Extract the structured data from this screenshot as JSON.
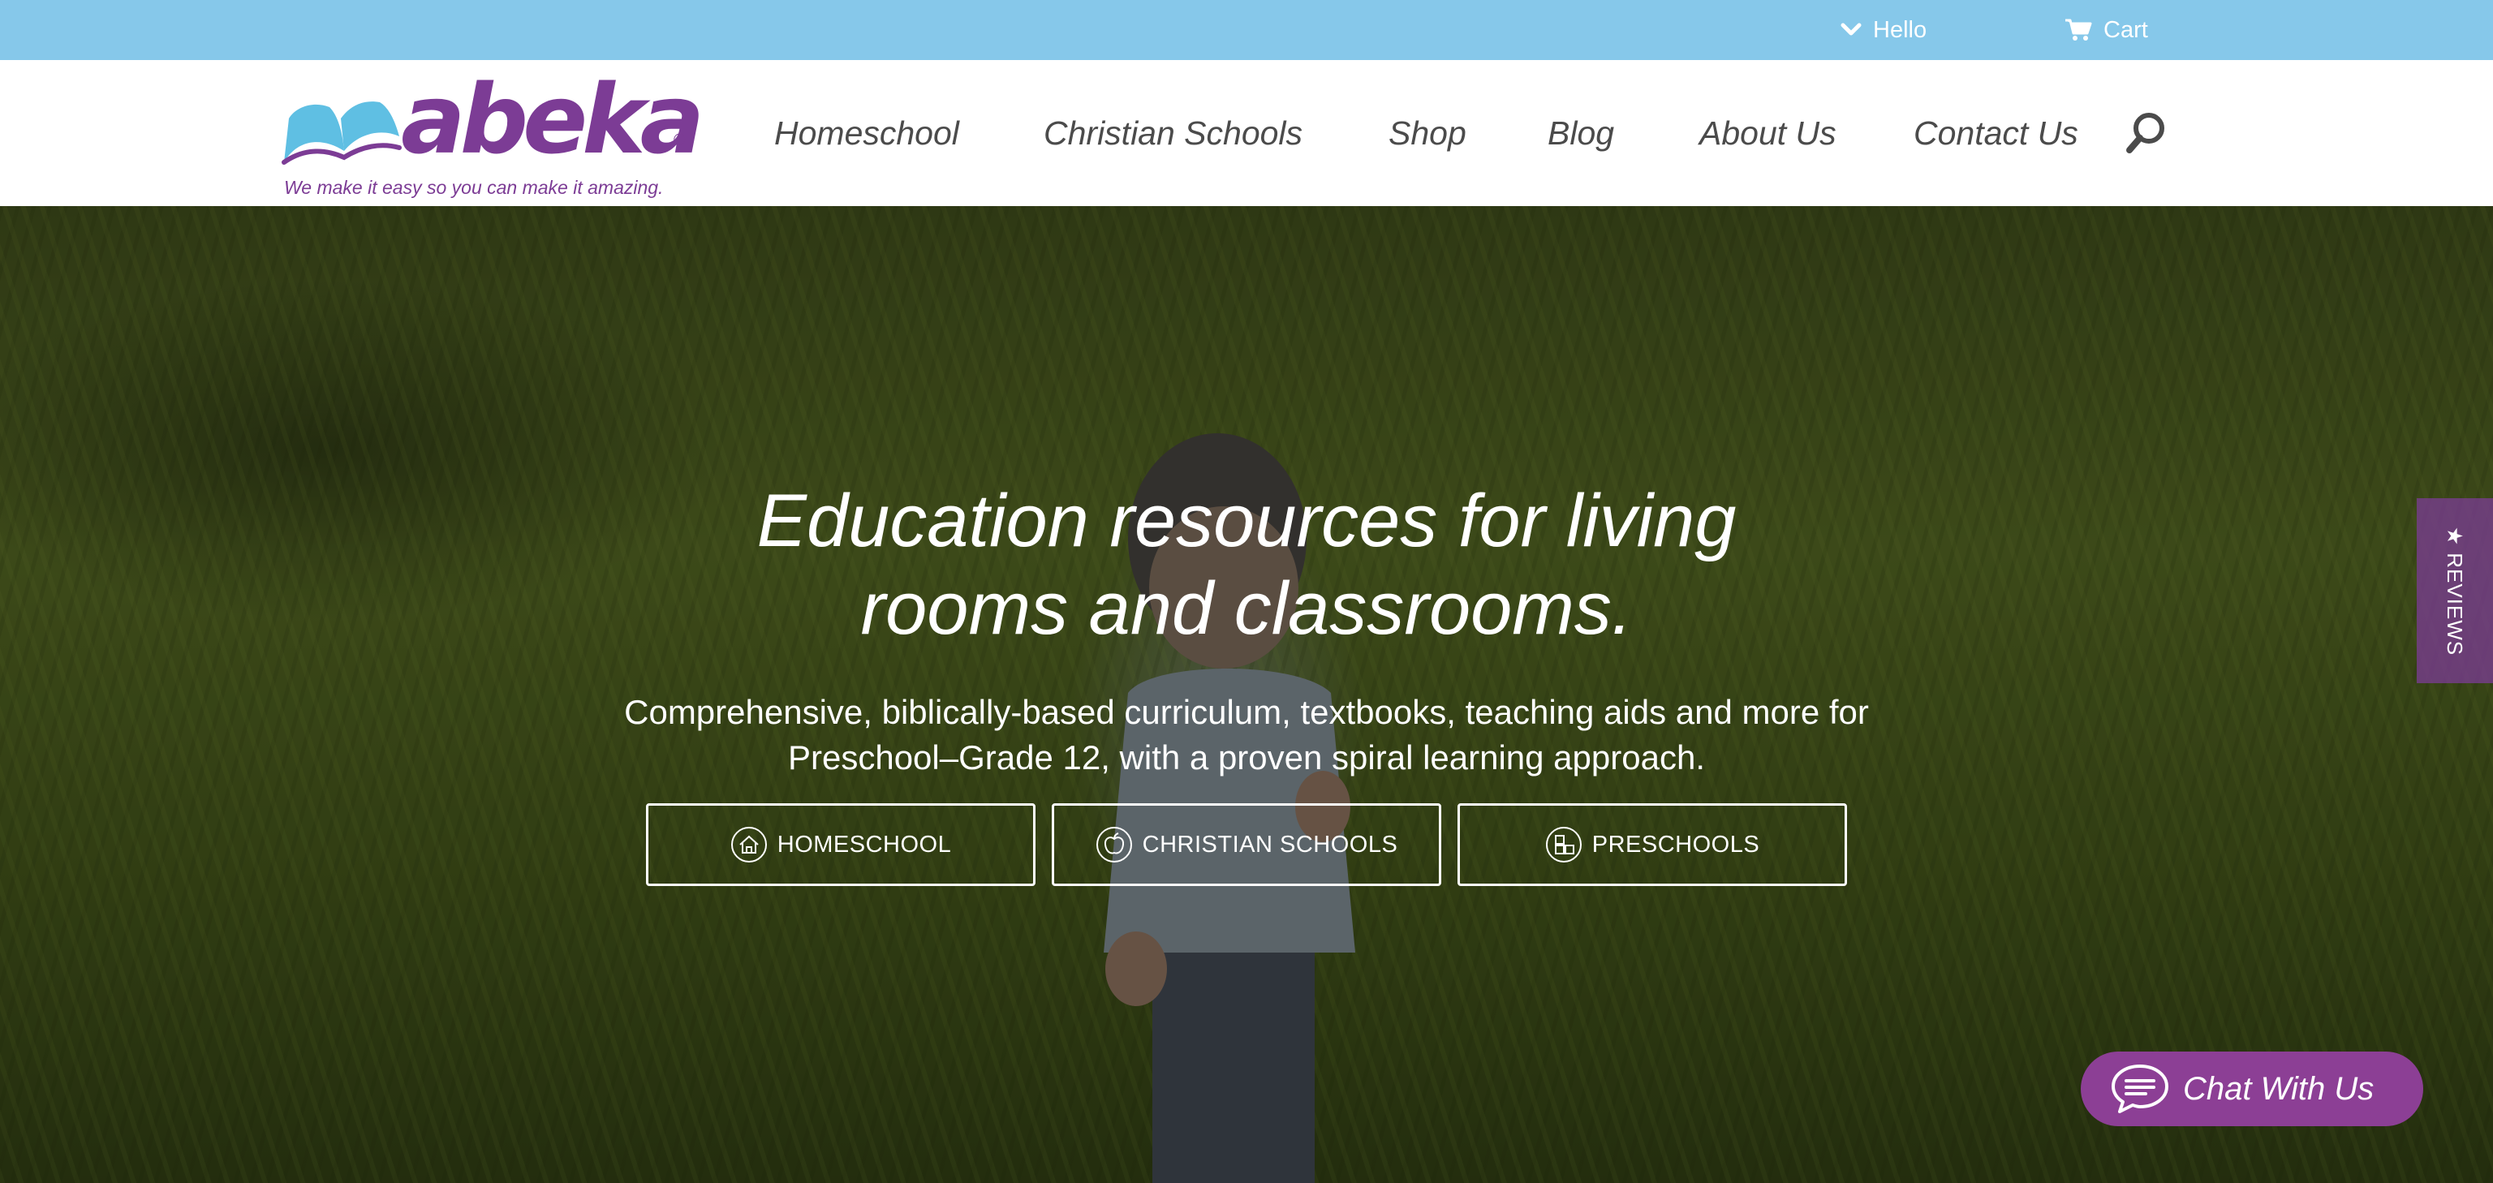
{
  "topbar": {
    "hello_label": "Hello",
    "cart_label": "Cart"
  },
  "logo": {
    "wordmark": "abeka",
    "registered": "®",
    "tagline": "We make it easy so you can make it amazing."
  },
  "nav": {
    "items": [
      {
        "label": "Homeschool"
      },
      {
        "label": "Christian Schools"
      },
      {
        "label": "Shop"
      },
      {
        "label": "Blog"
      },
      {
        "label": "About Us"
      },
      {
        "label": "Contact Us"
      }
    ],
    "search_icon": "search-icon"
  },
  "hero": {
    "title_line1": "Education resources for living",
    "title_line2": "rooms and classrooms.",
    "subtitle_line1": "Comprehensive, biblically-based curriculum, textbooks, teaching aids and more for",
    "subtitle_line2": "Preschool–Grade 12, with a proven spiral learning approach.",
    "buttons": [
      {
        "label": "HOMESCHOOL",
        "icon": "house-icon"
      },
      {
        "label": "CHRISTIAN SCHOOLS",
        "icon": "apple-icon"
      },
      {
        "label": "PRESCHOOLS",
        "icon": "blocks-icon"
      }
    ]
  },
  "reviews_tab": {
    "label": "REVIEWS",
    "icon": "star-icon"
  },
  "chat": {
    "label": "Chat With Us",
    "icon": "chat-bubble-icon"
  },
  "colors": {
    "topbar": "#86c8ea",
    "brand_purple": "#7c3c95",
    "logo_blue": "#5fbfe3",
    "chat_purple": "#8c3f95",
    "nav_text": "#4b4b4b"
  }
}
